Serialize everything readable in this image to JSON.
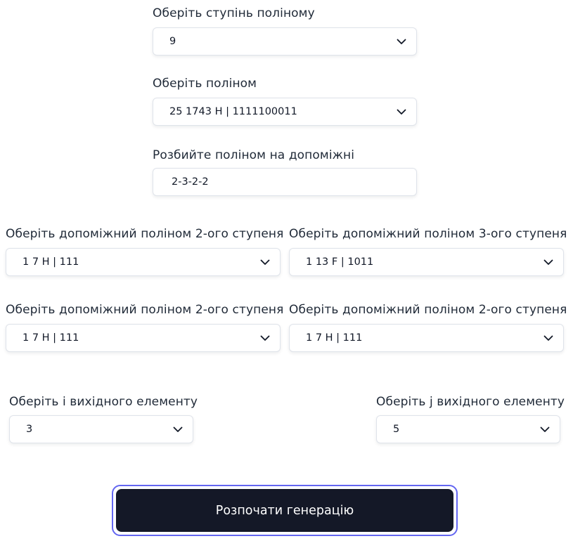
{
  "degree": {
    "label": "Оберіть ступінь поліному",
    "value": "9"
  },
  "polynomial": {
    "label": "Оберіть поліном",
    "value": "25 1743 H | 1111100011"
  },
  "split": {
    "label": "Розбийте поліном на допоміжні",
    "value": "2-3-2-2"
  },
  "aux": [
    {
      "label": "Оберіть допоміжний поліном 2-ого ступеня",
      "value": "1 7 H | 111"
    },
    {
      "label": "Оберіть допоміжний поліном 3-ого ступеня",
      "value": "1 13 F | 1011"
    },
    {
      "label": "Оберіть допоміжний поліном 2-ого ступеня",
      "value": "1 7 H | 111"
    },
    {
      "label": "Оберіть допоміжний поліном 2-ого ступеня",
      "value": "1 7 H | 111"
    }
  ],
  "output_i": {
    "label": "Оберіть і вихідного елементу",
    "value": "3"
  },
  "output_j": {
    "label": "Оберіть j вихідного елементу",
    "value": "5"
  },
  "submit_label": "Розпочати генерацію",
  "icons": {
    "dropdown": "chevron-down-icon"
  },
  "colors": {
    "button_bg": "#141827",
    "focus_ring": "#6366f1"
  }
}
